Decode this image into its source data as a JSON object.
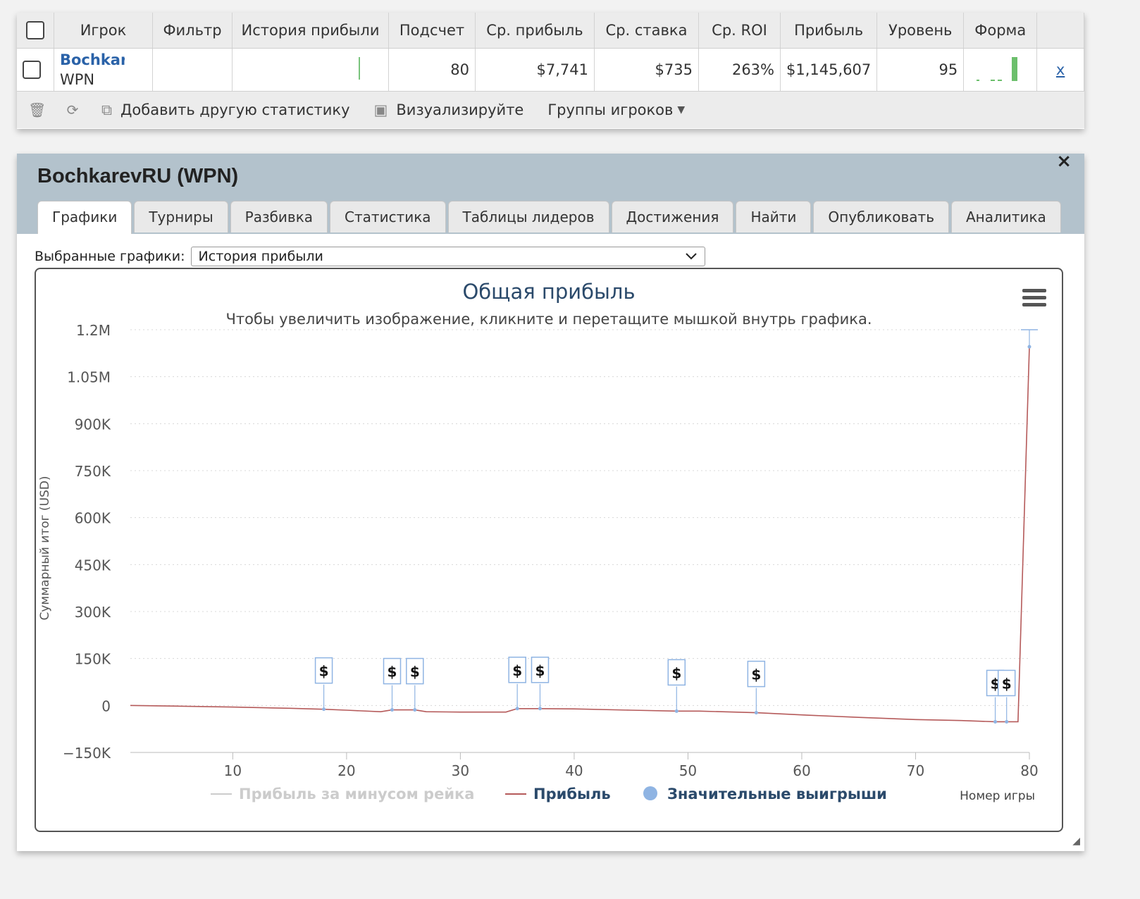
{
  "stats": {
    "headers": [
      "Игрок",
      "Фильтр",
      "История прибыли",
      "Подсчет",
      "Ср. прибыль",
      "Ср. ставка",
      "Ср. ROI",
      "Прибыль",
      "Уровень",
      "Форма"
    ],
    "row": {
      "player": "Bochkar",
      "network": "WPN",
      "count": "80",
      "avg_profit": "$7,741",
      "avg_stake": "$735",
      "avg_roi": "263%",
      "profit": "$1,145,607",
      "level": "95",
      "remove": "x"
    },
    "toolbar": {
      "add_stat": "Добавить другую статистику",
      "visualize": "Визуализируйте",
      "groups": "Группы игроков"
    }
  },
  "window": {
    "title": "BochkarevRU (WPN)",
    "close": "×",
    "tabs": [
      "Графики",
      "Турниры",
      "Разбивка",
      "Статистика",
      "Таблицы лидеров",
      "Достижения",
      "Найти",
      "Опубликовать",
      "Аналитика"
    ],
    "selected_label": "Выбранные графики:",
    "selected_value": "История прибыли"
  },
  "colors": {
    "profit": "#b55a5a",
    "significant": "#8fb4e3",
    "ex_rake": "#cccccc"
  },
  "chart_data": {
    "type": "line",
    "title": "Общая прибыль",
    "subtitle": "Чтобы увеличить изображение, кликните и перетащите мышкой внутрь графика.",
    "xlabel": "Номер игры",
    "ylabel": "Суммарный итог (USD)",
    "xlim": [
      1,
      80
    ],
    "ylim": [
      -150000,
      1200000
    ],
    "x_ticks": [
      "10",
      "20",
      "30",
      "40",
      "50",
      "60",
      "70",
      "80"
    ],
    "y_ticks": [
      "1.2M",
      "1.05M",
      "900K",
      "750K",
      "600K",
      "450K",
      "300K",
      "150K",
      "0",
      "−150K"
    ],
    "series": [
      {
        "name": "Прибыль за минусом рейка",
        "values": []
      },
      {
        "name": "Прибыль",
        "x": [
          1,
          5,
          10,
          15,
          18,
          20,
          23,
          24,
          26,
          27,
          30,
          34,
          35,
          37,
          40,
          45,
          49,
          51,
          56,
          60,
          65,
          70,
          74,
          77,
          78,
          79,
          80
        ],
        "values": [
          0,
          -2000,
          -5000,
          -9000,
          -12000,
          -15000,
          -20000,
          -14000,
          -14000,
          -20000,
          -21000,
          -21000,
          -10000,
          -10000,
          -11000,
          -15000,
          -18000,
          -18000,
          -23000,
          -30000,
          -38000,
          -45000,
          -48000,
          -52000,
          -52000,
          -52000,
          1145607
        ]
      }
    ],
    "significant_wins": {
      "name": "Значительные выигрыши",
      "marker": "$",
      "x": [
        18,
        24,
        26,
        35,
        37,
        49,
        56,
        77,
        78,
        80
      ]
    },
    "grid": true,
    "legend_position": "bottom"
  }
}
